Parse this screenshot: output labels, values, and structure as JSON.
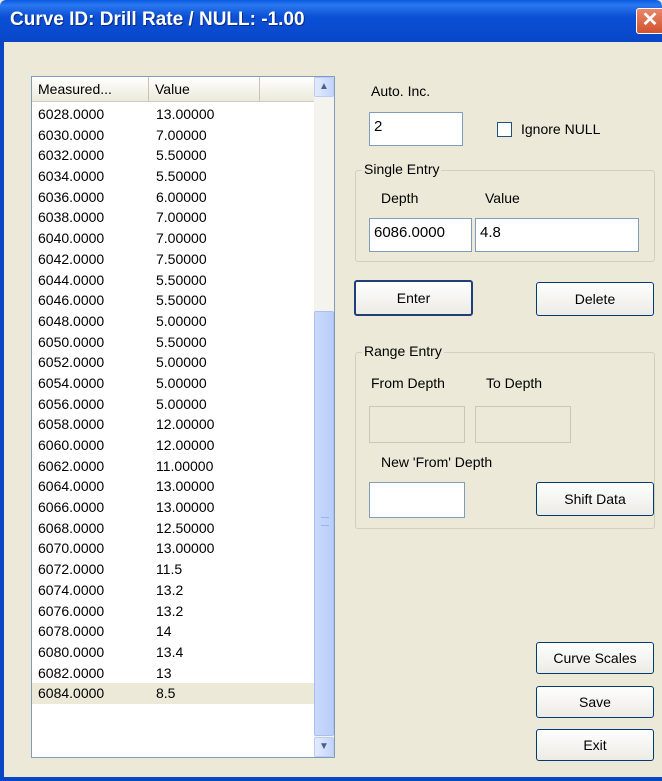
{
  "window": {
    "title": "Curve ID: Drill Rate / NULL: -1.00",
    "close_glyph": "✕"
  },
  "list": {
    "columns": [
      "Measured...",
      "Value"
    ],
    "rows": [
      {
        "depth": "6028.0000",
        "value": "13.00000"
      },
      {
        "depth": "6030.0000",
        "value": "7.00000"
      },
      {
        "depth": "6032.0000",
        "value": "5.50000"
      },
      {
        "depth": "6034.0000",
        "value": "5.50000"
      },
      {
        "depth": "6036.0000",
        "value": "6.00000"
      },
      {
        "depth": "6038.0000",
        "value": "7.00000"
      },
      {
        "depth": "6040.0000",
        "value": "7.00000"
      },
      {
        "depth": "6042.0000",
        "value": "7.50000"
      },
      {
        "depth": "6044.0000",
        "value": "5.50000"
      },
      {
        "depth": "6046.0000",
        "value": "5.50000"
      },
      {
        "depth": "6048.0000",
        "value": "5.00000"
      },
      {
        "depth": "6050.0000",
        "value": "5.50000"
      },
      {
        "depth": "6052.0000",
        "value": "5.00000"
      },
      {
        "depth": "6054.0000",
        "value": "5.00000"
      },
      {
        "depth": "6056.0000",
        "value": "5.00000"
      },
      {
        "depth": "6058.0000",
        "value": "12.00000"
      },
      {
        "depth": "6060.0000",
        "value": "12.00000"
      },
      {
        "depth": "6062.0000",
        "value": "11.00000"
      },
      {
        "depth": "6064.0000",
        "value": "13.00000"
      },
      {
        "depth": "6066.0000",
        "value": "13.00000"
      },
      {
        "depth": "6068.0000",
        "value": "12.50000"
      },
      {
        "depth": "6070.0000",
        "value": "13.00000"
      },
      {
        "depth": "6072.0000",
        "value": "11.5"
      },
      {
        "depth": "6074.0000",
        "value": "13.2"
      },
      {
        "depth": "6076.0000",
        "value": "13.2"
      },
      {
        "depth": "6078.0000",
        "value": "14"
      },
      {
        "depth": "6080.0000",
        "value": "13.4"
      },
      {
        "depth": "6082.0000",
        "value": "13"
      },
      {
        "depth": "6084.0000",
        "value": "8.5"
      }
    ],
    "selected_index": 28
  },
  "auto_inc": {
    "label": "Auto. Inc.",
    "value": "2"
  },
  "ignore_null": {
    "label": "Ignore NULL",
    "checked": false
  },
  "single_entry": {
    "caption": "Single Entry",
    "depth_label": "Depth",
    "value_label": "Value",
    "depth_value": "6086.0000",
    "value_value": "4.8"
  },
  "buttons": {
    "enter": "Enter",
    "delete": "Delete",
    "shift_data": "Shift Data",
    "curve_scales": "Curve Scales",
    "save": "Save",
    "exit": "Exit"
  },
  "range_entry": {
    "caption": "Range Entry",
    "from_label": "From Depth",
    "to_label": "To Depth",
    "new_from_label": "New 'From' Depth",
    "from_value": "",
    "to_value": "",
    "new_from_value": ""
  }
}
